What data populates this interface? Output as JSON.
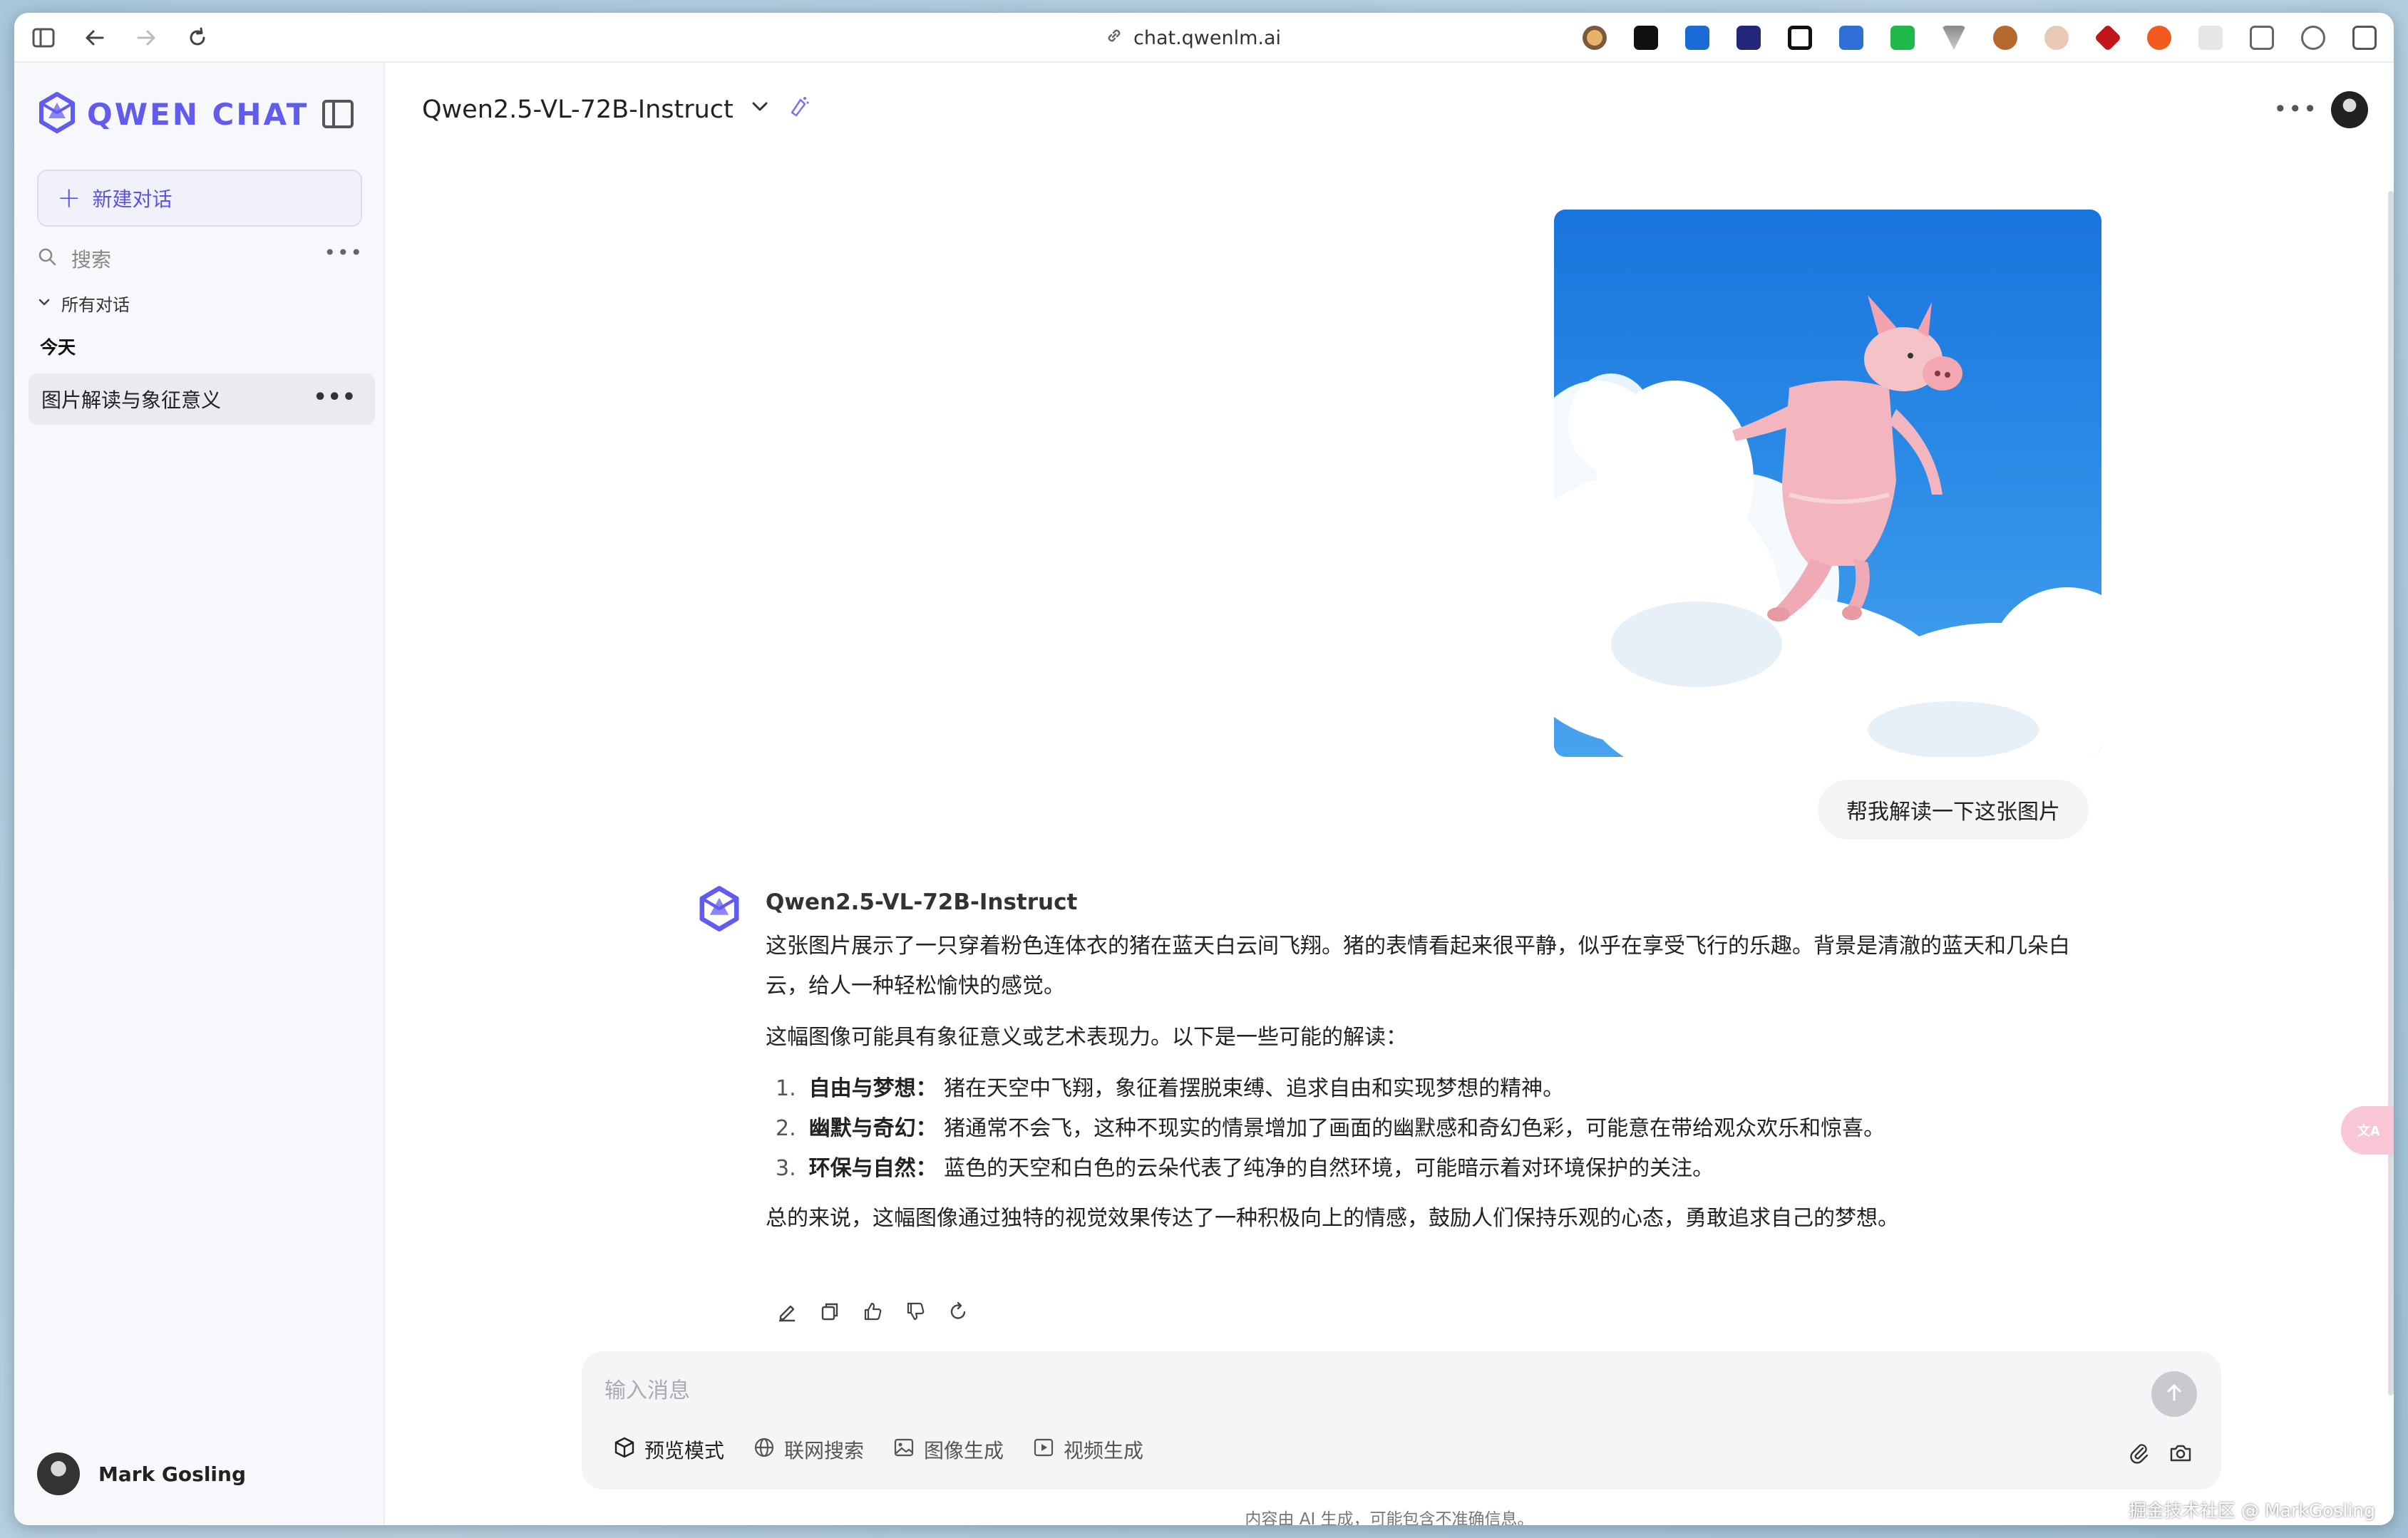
{
  "browser": {
    "url": "chat.qwenlm.ai"
  },
  "sidebar": {
    "logo_text": "QWEN CHAT",
    "new_chat_label": "新建对话",
    "search_placeholder": "搜索",
    "section_label": "所有对话",
    "group_today": "今天",
    "conversations": [
      {
        "title": "图片解读与象征意义"
      }
    ],
    "user_name": "Mark Gosling"
  },
  "header": {
    "model_name": "Qwen2.5-VL-72B-Instruct"
  },
  "chat": {
    "user_message": "帮我解读一下这张图片",
    "bot_name": "Qwen2.5-VL-72B-Instruct",
    "paragraph_1": "这张图片展示了一只穿着粉色连体衣的猪在蓝天白云间飞翔。猪的表情看起来很平静，似乎在享受飞行的乐趣。背景是清澈的蓝天和几朵白云，给人一种轻松愉快的感觉。",
    "paragraph_2": "这幅图像可能具有象征意义或艺术表现力。以下是一些可能的解读：",
    "list": [
      {
        "num": "1.",
        "title": "自由与梦想：",
        "text": "猪在天空中飞翔，象征着摆脱束缚、追求自由和实现梦想的精神。"
      },
      {
        "num": "2.",
        "title": "幽默与奇幻：",
        "text": "猪通常不会飞，这种不现实的情景增加了画面的幽默感和奇幻色彩，可能意在带给观众欢乐和惊喜。"
      },
      {
        "num": "3.",
        "title": "环保与自然：",
        "text": "蓝色的天空和白色的云朵代表了纯净的自然环境，可能暗示着对环境保护的关注。"
      }
    ],
    "paragraph_3": "总的来说，这幅图像通过独特的视觉效果传达了一种积极向上的情感，鼓励人们保持乐观的心态，勇敢追求自己的梦想。"
  },
  "composer": {
    "placeholder": "输入消息",
    "chips": [
      "预览模式",
      "联网搜索",
      "图像生成",
      "视频生成"
    ]
  },
  "footer": {
    "disclaimer": "内容由 AI 生成，可能包含不准确信息。",
    "watermark": "掘金技术社区 @ MarkGosling"
  },
  "colors": {
    "brand": "#615ced",
    "sidebar_bg": "#f7f8fb",
    "selected_item": "#e9ebf0",
    "composer_bg": "#f4f5f7",
    "sky": "#2a8ae6"
  },
  "icons": [
    "sidebar-toggle-icon",
    "back-icon",
    "forward-icon",
    "reload-icon",
    "link-icon",
    "qwen-logo-icon",
    "panel-collapse-icon",
    "plus-icon",
    "search-icon",
    "chevron-down-icon",
    "more-icon",
    "edit-icon",
    "copy-icon",
    "thumbs-up-icon",
    "thumbs-down-icon",
    "regenerate-icon",
    "send-icon",
    "cube-icon",
    "globe-icon",
    "image-icon",
    "video-icon",
    "attach-icon",
    "camera-icon",
    "translate-icon"
  ]
}
